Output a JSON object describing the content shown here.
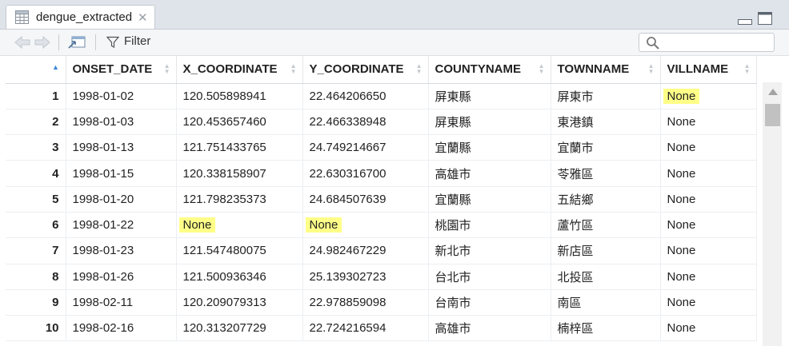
{
  "tab": {
    "title": "dengue_extracted",
    "close_glyph": "✕"
  },
  "toolbar": {
    "filter_label": "Filter",
    "search_placeholder": ""
  },
  "columns": [
    "ONSET_DATE",
    "X_COORDINATE",
    "Y_COORDINATE",
    "COUNTYNAME",
    "TOWNNAME",
    "VILLNAME"
  ],
  "rows": [
    {
      "num": "1",
      "onset": "1998-01-02",
      "x": "120.505898941",
      "y": "22.464206650",
      "county": "屏東縣",
      "town": "屏東市",
      "vill": "None"
    },
    {
      "num": "2",
      "onset": "1998-01-03",
      "x": "120.453657460",
      "y": "22.466338948",
      "county": "屏東縣",
      "town": "東港鎮",
      "vill": "None"
    },
    {
      "num": "3",
      "onset": "1998-01-13",
      "x": "121.751433765",
      "y": "24.749214667",
      "county": "宜蘭縣",
      "town": "宜蘭市",
      "vill": "None"
    },
    {
      "num": "4",
      "onset": "1998-01-15",
      "x": "120.338158907",
      "y": "22.630316700",
      "county": "高雄市",
      "town": "苓雅區",
      "vill": "None"
    },
    {
      "num": "5",
      "onset": "1998-01-20",
      "x": "121.798235373",
      "y": "24.684507639",
      "county": "宜蘭縣",
      "town": "五結鄉",
      "vill": "None"
    },
    {
      "num": "6",
      "onset": "1998-01-22",
      "x": "None",
      "y": "None",
      "county": "桃園市",
      "town": "蘆竹區",
      "vill": "None"
    },
    {
      "num": "7",
      "onset": "1998-01-23",
      "x": "121.547480075",
      "y": "24.982467229",
      "county": "新北市",
      "town": "新店區",
      "vill": "None"
    },
    {
      "num": "8",
      "onset": "1998-01-26",
      "x": "121.500936346",
      "y": "25.139302723",
      "county": "台北市",
      "town": "北投區",
      "vill": "None"
    },
    {
      "num": "9",
      "onset": "1998-02-11",
      "x": "120.209079313",
      "y": "22.978859098",
      "county": "台南市",
      "town": "南區",
      "vill": "None"
    },
    {
      "num": "10",
      "onset": "1998-02-16",
      "x": "120.313207729",
      "y": "22.724216594",
      "county": "高雄市",
      "town": "楠梓區",
      "vill": "None"
    }
  ],
  "highlight_color": "#ffff88",
  "sort_indicator_color": "#3a86d9"
}
